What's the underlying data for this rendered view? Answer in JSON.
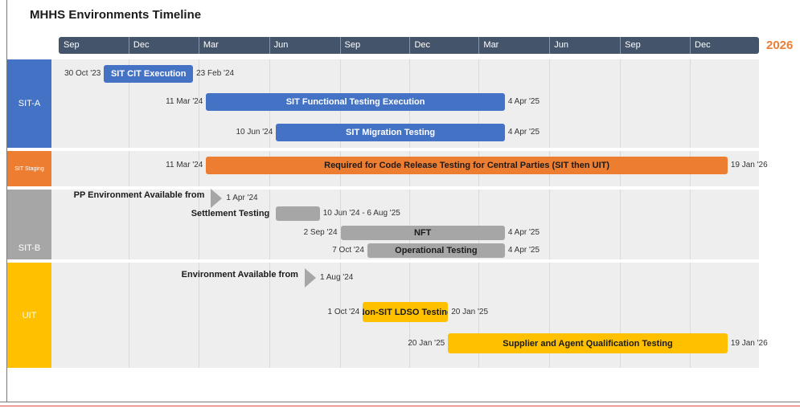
{
  "title": "MHHS Environments Timeline",
  "chart_data": {
    "type": "gantt",
    "year_label": "2026",
    "months": [
      "Sep",
      "Dec",
      "Mar",
      "Jun",
      "Sep",
      "Dec",
      "Mar",
      "Jun",
      "Sep",
      "Dec"
    ],
    "x_range": [
      "2023-09-01",
      "2026-03-01"
    ],
    "colors": {
      "header": "#44546a",
      "blue": "#4472c4",
      "orange": "#ed7d31",
      "grey": "#a6a6a6",
      "yellow": "#ffc000"
    },
    "lanes": [
      {
        "label": "SIT-A",
        "color": "#4472c4",
        "tasks": [
          {
            "name": "SIT CIT Execution",
            "start": "2023-10-30",
            "end": "2024-02-23",
            "start_label": "30 Oct '23",
            "end_label": "23 Feb '24",
            "color": "#4472c4",
            "text_color": "#ffffff"
          },
          {
            "name": "SIT Functional Testing Execution",
            "start": "2024-03-11",
            "end": "2025-04-04",
            "start_label": "11 Mar '24",
            "end_label": "4 Apr '25",
            "color": "#4472c4",
            "text_color": "#ffffff"
          },
          {
            "name": "SIT Migration Testing",
            "start": "2024-06-10",
            "end": "2025-04-04",
            "start_label": "10 Jun '24",
            "end_label": "4 Apr '25",
            "color": "#4472c4",
            "text_color": "#ffffff"
          }
        ]
      },
      {
        "label": "SIT Staging",
        "color": "#ed7d31",
        "tasks": [
          {
            "name": "Required for Code Release Testing for Central Parties (SIT then UIT)",
            "start": "2024-03-11",
            "end": "2026-01-19",
            "start_label": "11 Mar '24",
            "end_label": "19 Jan '26",
            "color": "#ed7d31",
            "text_color": "#1b1b1b"
          }
        ]
      },
      {
        "label": "SIT-B",
        "color": "#a6a6a6",
        "milestones": [
          {
            "name": "PP Environment Available from",
            "date": "2024-04-01",
            "label": "1 Apr '24"
          }
        ],
        "tasks": [
          {
            "name": "",
            "outside_name": "Settlement Testing",
            "start": "2024-06-10",
            "end": "2024-08-06",
            "range_label": "10 Jun '24 - 6 Aug '25",
            "color": "#a6a6a6",
            "text_color": "#1b1b1b"
          },
          {
            "name": "NFT",
            "start": "2024-09-02",
            "end": "2025-04-04",
            "start_label": "2 Sep '24",
            "end_label": "4 Apr '25",
            "color": "#a6a6a6",
            "text_color": "#1b1b1b"
          },
          {
            "name": "Operational Testing",
            "start": "2024-10-07",
            "end": "2025-04-04",
            "start_label": "7 Oct '24",
            "end_label": "4 Apr '25",
            "color": "#a6a6a6",
            "text_color": "#1b1b1b"
          }
        ]
      },
      {
        "label": "UIT",
        "color": "#ffc000",
        "milestones": [
          {
            "name": "Environment Available from",
            "date": "2024-08-01",
            "label": "1 Aug '24"
          }
        ],
        "tasks": [
          {
            "name": "Non-SIT LDSO Testing",
            "start": "2024-10-01",
            "end": "2025-01-20",
            "start_label": "1 Oct '24",
            "end_label": "20 Jan '25",
            "color": "#ffc000",
            "text_color": "#1b1b1b"
          },
          {
            "name": "Supplier and Agent Qualification Testing",
            "start": "2025-01-20",
            "end": "2026-01-19",
            "start_label": "20 Jan '25",
            "end_label": "19 Jan '26",
            "color": "#ffc000",
            "text_color": "#1b1b1b"
          }
        ]
      }
    ]
  }
}
